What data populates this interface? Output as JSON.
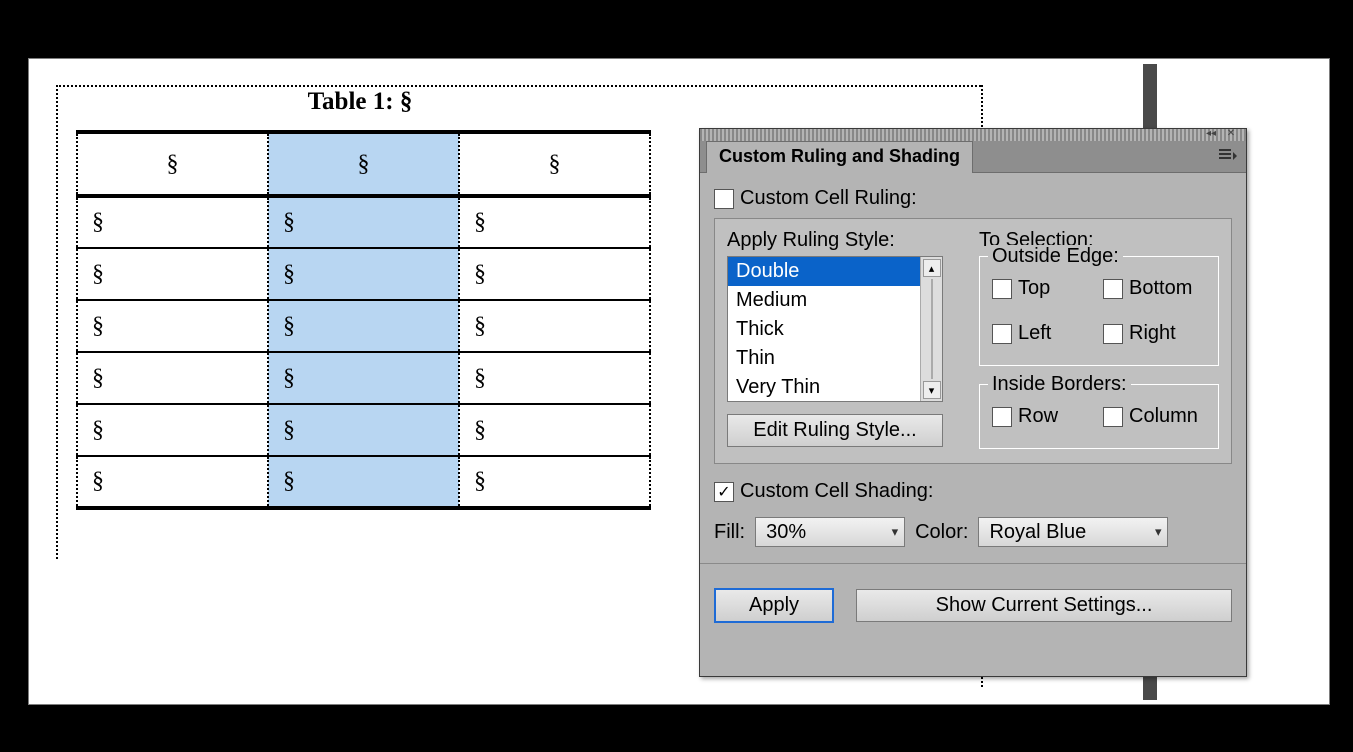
{
  "document": {
    "caption": "Table 1: §",
    "cell_mark": "§",
    "rows": 7,
    "cols": 3,
    "highlight_col": 2,
    "highlight_color": "#b8d6f2"
  },
  "panel": {
    "title": "Custom Ruling and Shading",
    "collapse_glyph": "◂◂",
    "close_glyph": "✕",
    "ruling": {
      "checkbox_label": "Custom Cell Ruling:",
      "checked": false,
      "apply_label": "Apply Ruling Style:",
      "styles": [
        "Double",
        "Medium",
        "Thick",
        "Thin",
        "Very Thin"
      ],
      "selected_style": "Double",
      "edit_button": "Edit Ruling Style...",
      "to_selection_label": "To Selection:",
      "outside_legend": "Outside Edge:",
      "outside": {
        "top": {
          "label": "Top",
          "checked": false
        },
        "bottom": {
          "label": "Bottom",
          "checked": false
        },
        "left": {
          "label": "Left",
          "checked": false
        },
        "right": {
          "label": "Right",
          "checked": false
        }
      },
      "inside_legend": "Inside Borders:",
      "inside": {
        "row": {
          "label": "Row",
          "checked": false
        },
        "column": {
          "label": "Column",
          "checked": false
        }
      }
    },
    "shading": {
      "checkbox_label": "Custom Cell Shading:",
      "checked": true,
      "fill_label": "Fill:",
      "fill_value": "30%",
      "color_label": "Color:",
      "color_value": "Royal Blue"
    },
    "footer": {
      "apply": "Apply",
      "show": "Show Current Settings..."
    }
  }
}
